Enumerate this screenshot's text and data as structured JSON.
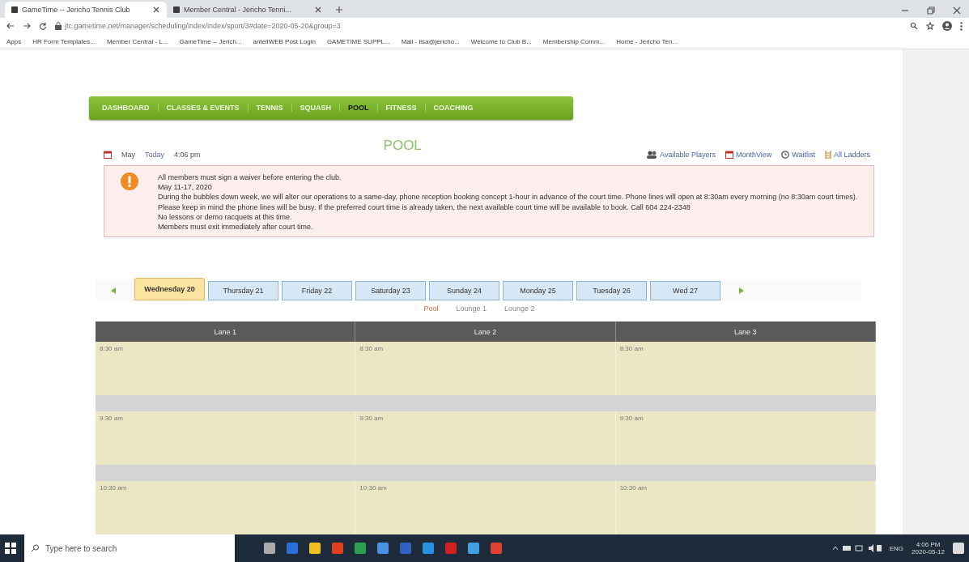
{
  "browser": {
    "tabs": [
      {
        "title": "GameTime -- Jericho Tennis Club",
        "selected": true
      },
      {
        "title": "Member Central - Jericho Tenni...",
        "selected": false
      }
    ],
    "address": "jtc.gametime.net/manager/scheduling/index/index/sport/3#date=2020-05-20&group=3",
    "bookmarks": [
      "Apps",
      "HR Form Templates...",
      "Member Central - L...",
      "GameTime -- Jerich...",
      "antellWEB Post Login",
      "GAMETIME SUPPL...",
      "Mail - lisa@jericho...",
      "Welcome to Club B...",
      "Membership Comm...",
      "Home - Jericho Ten..."
    ]
  },
  "nav": [
    {
      "label": "DASHBOARD",
      "selected": false
    },
    {
      "label": "CLASSES & EVENTS",
      "selected": false
    },
    {
      "label": "TENNIS",
      "selected": false
    },
    {
      "label": "SQUASH",
      "selected": false
    },
    {
      "label": "POOL",
      "selected": true
    },
    {
      "label": "FITNESS",
      "selected": false
    },
    {
      "label": "COACHING",
      "selected": false
    }
  ],
  "info": {
    "month": "May",
    "today": "Today",
    "time": "4:06 pm",
    "title": "POOL"
  },
  "links": [
    "Available Players",
    "MonthView",
    "Waitlist",
    "All Ladders"
  ],
  "alert": [
    "All members must sign a waiver before entering the club.",
    "May 11-17, 2020",
    "During the bubbles down week, we will alter our operations to a same-day, phone reception booking concept 1-hour in advance of the court time. Phone lines will open at 8:30am every morning (no 8:30am court times). Please keep in mind the phone lines will be busy. If the preferred court time is already taken, the next available court time will be available to book. Call 604 224-2348",
    "No lessons or demo racquets at this time.",
    "Members must exit immediately after court time."
  ],
  "days": [
    {
      "label": "Wednesday 20",
      "selected": true
    },
    {
      "label": "Thursday 21",
      "selected": false
    },
    {
      "label": "Friday 22",
      "selected": false
    },
    {
      "label": "Saturday 23",
      "selected": false
    },
    {
      "label": "Sunday 24",
      "selected": false
    },
    {
      "label": "Monday 25",
      "selected": false
    },
    {
      "label": "Tuesday 26",
      "selected": false
    },
    {
      "label": "Wed 27",
      "selected": false
    }
  ],
  "areas": [
    {
      "label": "Pool",
      "selected": true
    },
    {
      "label": "Lounge 1",
      "selected": false
    },
    {
      "label": "Lounge 2",
      "selected": false
    }
  ],
  "table": {
    "columns": [
      "Lane 1",
      "Lane 2",
      "Lane 3"
    ],
    "rows": [
      [
        "8:30 am",
        "8:30 am",
        "8:30 am"
      ],
      [
        "9:30 am",
        "9:30 am",
        "9:30 am"
      ],
      [
        "10:30 am",
        "10:30 am",
        "10:30 am"
      ]
    ]
  },
  "taskbar": {
    "search": "Type here to search",
    "lang": "ENG",
    "time": "4:06 PM",
    "date": "2020-05-12"
  }
}
